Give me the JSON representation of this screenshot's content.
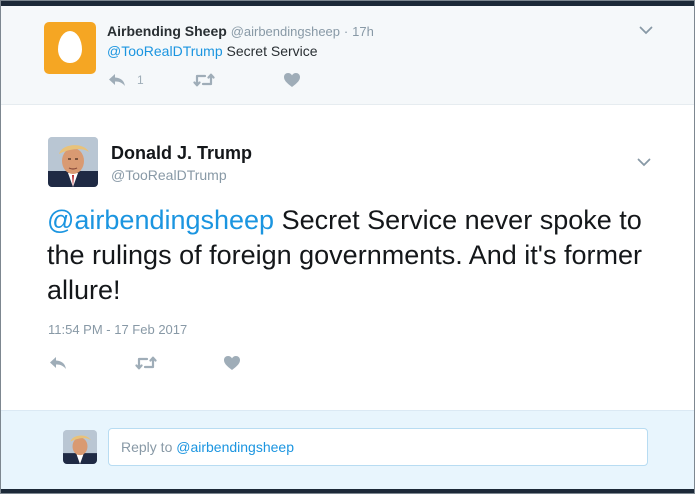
{
  "parent_tweet": {
    "author_name": "Airbending Sheep",
    "author_handle": "@airbendingsheep",
    "separator": "·",
    "time_ago": "17h",
    "mention": "@TooRealDTrump",
    "text": " Secret Service",
    "reply_count": "1",
    "avatar_icon": "default-egg-avatar",
    "avatar_color": "#f5a623"
  },
  "main_tweet": {
    "author_name": "Donald J. Trump",
    "author_handle": "@TooRealDTrump",
    "mention": "@airbendingsheep",
    "text": " Secret Service never spoke to the rulings of foreign governments. And it's former allure!",
    "timestamp": "11:54 PM - 17 Feb 2017"
  },
  "reply_box": {
    "prefix": "Reply to ",
    "mention": "@airbendingsheep"
  },
  "colors": {
    "link": "#1b95e0",
    "text": "#14171a",
    "muted": "#8899a6",
    "reply_bg": "#e8f5fd",
    "parent_bg": "#f5f8fa"
  }
}
